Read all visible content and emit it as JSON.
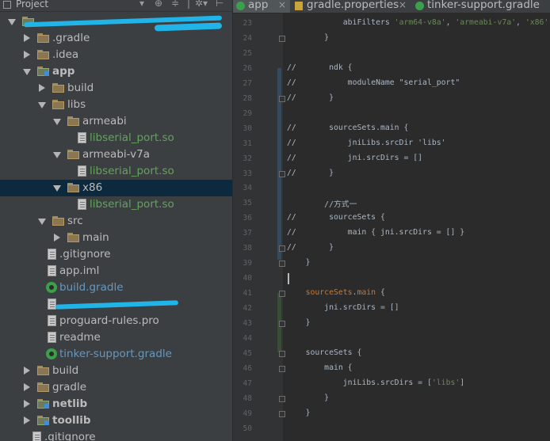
{
  "project_panel": {
    "title": "Project",
    "tree": [
      {
        "label": "",
        "indent": 0,
        "expanded": true,
        "icon": "module-folder-icon",
        "redacted": true
      },
      {
        "label": ".gradle",
        "indent": 1,
        "expanded": false,
        "icon": "folder-icon"
      },
      {
        "label": ".idea",
        "indent": 1,
        "expanded": false,
        "icon": "folder-icon"
      },
      {
        "label": "app",
        "indent": 1,
        "expanded": true,
        "icon": "module-folder-icon",
        "style": "bold"
      },
      {
        "label": "build",
        "indent": 2,
        "expanded": false,
        "icon": "folder-icon"
      },
      {
        "label": "libs",
        "indent": 2,
        "expanded": true,
        "icon": "folder-icon"
      },
      {
        "label": "armeabi",
        "indent": 3,
        "expanded": true,
        "icon": "folder-icon"
      },
      {
        "label": "libserial_port.so",
        "indent": 4,
        "icon": "file-icon",
        "style": "green"
      },
      {
        "label": "armeabi-v7a",
        "indent": 3,
        "expanded": true,
        "icon": "folder-icon"
      },
      {
        "label": "libserial_port.so",
        "indent": 4,
        "icon": "file-icon",
        "style": "green"
      },
      {
        "label": "x86",
        "indent": 3,
        "expanded": true,
        "icon": "folder-icon",
        "selected": true
      },
      {
        "label": "libserial_port.so",
        "indent": 4,
        "icon": "file-icon",
        "style": "green"
      },
      {
        "label": "src",
        "indent": 2,
        "expanded": true,
        "icon": "folder-icon"
      },
      {
        "label": "main",
        "indent": 3,
        "expanded": false,
        "icon": "folder-icon"
      },
      {
        "label": ".gitignore",
        "indent": 2,
        "icon": "file-icon"
      },
      {
        "label": "app.iml",
        "indent": 2,
        "icon": "file-icon"
      },
      {
        "label": "build.gradle",
        "indent": 2,
        "icon": "gradle-icon",
        "style": "blue"
      },
      {
        "label": "",
        "indent": 2,
        "icon": "file-icon",
        "redacted": true
      },
      {
        "label": "proguard-rules.pro",
        "indent": 2,
        "icon": "file-icon"
      },
      {
        "label": "readme",
        "indent": 2,
        "icon": "file-icon"
      },
      {
        "label": "tinker-support.gradle",
        "indent": 2,
        "icon": "gradle-icon",
        "style": "blue"
      },
      {
        "label": "build",
        "indent": 1,
        "expanded": false,
        "icon": "folder-icon"
      },
      {
        "label": "gradle",
        "indent": 1,
        "expanded": false,
        "icon": "folder-icon"
      },
      {
        "label": "netlib",
        "indent": 1,
        "expanded": false,
        "icon": "module-folder-icon",
        "style": "bold"
      },
      {
        "label": "toollib",
        "indent": 1,
        "expanded": false,
        "icon": "module-folder-icon",
        "style": "bold"
      },
      {
        "label": ".gitignore",
        "indent": 1,
        "icon": "file-icon"
      }
    ]
  },
  "tabs": [
    {
      "label": "app",
      "icon": "gradle-icon",
      "active": true
    },
    {
      "label": "gradle.properties",
      "icon": "properties-icon",
      "active": false
    },
    {
      "label": "tinker-support.gradle",
      "icon": "gradle-icon",
      "active": false
    }
  ],
  "editor": {
    "lines": [
      {
        "n": "23",
        "tokens": [
          {
            "t": "            abiFilters ",
            "c": ""
          },
          {
            "t": "'arm64-v8a'",
            "c": "str"
          },
          {
            "t": ", ",
            "c": ""
          },
          {
            "t": "'armeabi-v7a'",
            "c": "str"
          },
          {
            "t": ", ",
            "c": ""
          },
          {
            "t": "'x86'",
            "c": "str"
          }
        ]
      },
      {
        "n": "24",
        "tokens": [
          {
            "t": "        }",
            "c": ""
          }
        ]
      },
      {
        "n": "25",
        "tokens": []
      },
      {
        "n": "26",
        "tokens": [
          {
            "t": "//       ndk {",
            "c": ""
          }
        ]
      },
      {
        "n": "27",
        "tokens": [
          {
            "t": "//           moduleName ",
            "c": ""
          },
          {
            "t": "\"serial_port\"",
            "c": ""
          }
        ]
      },
      {
        "n": "28",
        "tokens": [
          {
            "t": "//       }",
            "c": ""
          }
        ]
      },
      {
        "n": "29",
        "tokens": []
      },
      {
        "n": "30",
        "tokens": [
          {
            "t": "//       sourceSets.main {",
            "c": ""
          }
        ]
      },
      {
        "n": "31",
        "tokens": [
          {
            "t": "//           jniLibs.srcDir 'libs'",
            "c": ""
          }
        ]
      },
      {
        "n": "32",
        "tokens": [
          {
            "t": "//           jni.srcDirs = []",
            "c": ""
          }
        ]
      },
      {
        "n": "33",
        "tokens": [
          {
            "t": "//       }",
            "c": ""
          }
        ]
      },
      {
        "n": "34",
        "tokens": []
      },
      {
        "n": "35",
        "tokens": [
          {
            "t": "        //方式一",
            "c": ""
          }
        ]
      },
      {
        "n": "36",
        "tokens": [
          {
            "t": "//       sourceSets {",
            "c": ""
          }
        ]
      },
      {
        "n": "37",
        "tokens": [
          {
            "t": "//           main { jni.srcDirs = [] }",
            "c": ""
          }
        ]
      },
      {
        "n": "38",
        "tokens": [
          {
            "t": "//       }",
            "c": ""
          }
        ]
      },
      {
        "n": "39",
        "tokens": [
          {
            "t": "    }",
            "c": ""
          }
        ]
      },
      {
        "n": "40",
        "tokens": []
      },
      {
        "n": "41",
        "tokens": [
          {
            "t": "    ",
            "c": ""
          },
          {
            "t": "sourceSets",
            "c": "kw"
          },
          {
            "t": ".",
            "c": ""
          },
          {
            "t": "main",
            "c": "kw"
          },
          {
            "t": " {",
            "c": ""
          }
        ]
      },
      {
        "n": "42",
        "tokens": [
          {
            "t": "        jni",
            "c": ""
          },
          {
            "t": ".",
            "c": ""
          },
          {
            "t": "srcDirs",
            "c": ""
          },
          {
            "t": " = []",
            "c": ""
          }
        ]
      },
      {
        "n": "43",
        "tokens": [
          {
            "t": "    }",
            "c": ""
          }
        ]
      },
      {
        "n": "44",
        "tokens": []
      },
      {
        "n": "45",
        "tokens": [
          {
            "t": "    sourceSets {",
            "c": ""
          }
        ]
      },
      {
        "n": "46",
        "tokens": [
          {
            "t": "        main {",
            "c": ""
          }
        ]
      },
      {
        "n": "47",
        "tokens": [
          {
            "t": "            jniLibs",
            "c": ""
          },
          {
            "t": ".",
            "c": ""
          },
          {
            "t": "srcDirs",
            "c": ""
          },
          {
            "t": " = [",
            "c": ""
          },
          {
            "t": "'libs'",
            "c": "str"
          },
          {
            "t": "]",
            "c": ""
          }
        ]
      },
      {
        "n": "48",
        "tokens": [
          {
            "t": "        }",
            "c": ""
          }
        ]
      },
      {
        "n": "49",
        "tokens": [
          {
            "t": "    }",
            "c": ""
          }
        ]
      },
      {
        "n": "50",
        "tokens": []
      }
    ]
  },
  "colors": {
    "panel_bg": "#3c3f41",
    "editor_bg": "#2b2b2b",
    "gutter_bg": "#313335",
    "selection": "#0d293e",
    "keyword": "#cc7832",
    "string": "#6a8759",
    "green_file": "#62a35c",
    "blue_file": "#6897bb"
  }
}
